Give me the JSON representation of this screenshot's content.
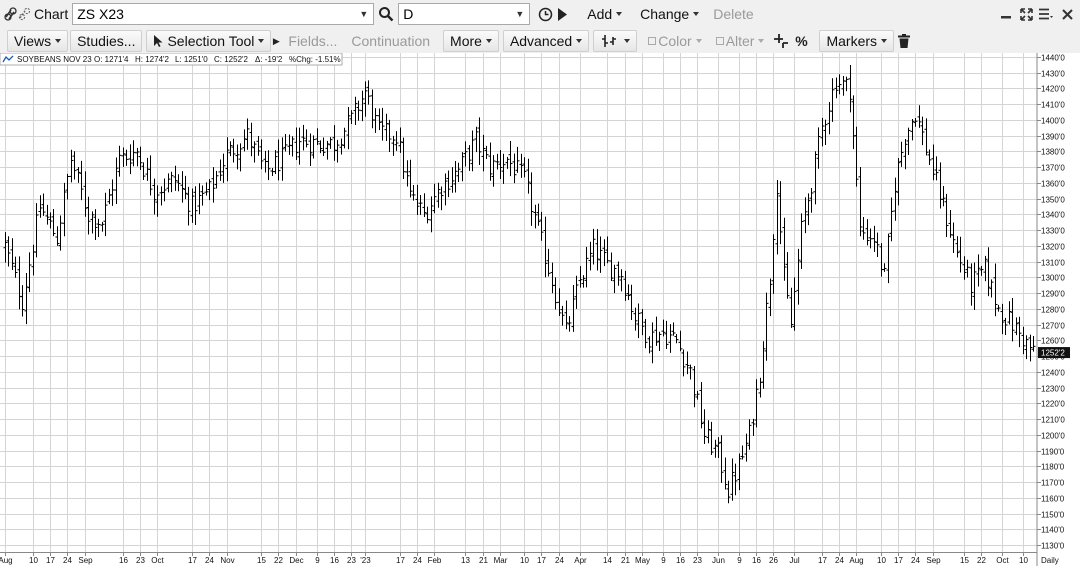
{
  "toolbar": {
    "chart_label": "Chart",
    "symbol": "ZS X23",
    "interval": "D",
    "add_label": "Add",
    "change_label": "Change",
    "delete_label": "Delete"
  },
  "toolbar2": {
    "views_label": "Views",
    "studies_label": "Studies...",
    "selection_tool_label": "Selection Tool",
    "fields_label": "Fields...",
    "continuation_label": "Continuation",
    "more_label": "More",
    "advanced_label": "Advanced",
    "color_label": "Color",
    "alter_label": "Alter",
    "percent_label": "%",
    "markers_label": "Markers"
  },
  "chart_data": {
    "type": "ohlc-bar",
    "title": "SOYBEANS NOV 23",
    "open_label": "O: 1271'4",
    "high_label": "H: 1274'2",
    "low_label": "L: 1251'0",
    "close_label": "C: 1252'2",
    "change_label": "Δ: -19'2",
    "pct_change_label": "%Chg: -1.51%",
    "last_price_label": "1252'2",
    "last_price": 1252.25,
    "period_label": "Daily",
    "ylim": [
      1125,
      1445
    ],
    "y_ticks": [
      "1440'0",
      "1430'0",
      "1420'0",
      "1410'0",
      "1400'0",
      "1390'0",
      "1380'0",
      "1370'0",
      "1360'0",
      "1350'0",
      "1340'0",
      "1330'0",
      "1320'0",
      "1310'0",
      "1300'0",
      "1290'0",
      "1280'0",
      "1270'0",
      "1260'0",
      "1250'0",
      "1240'0",
      "1230'0",
      "1220'0",
      "1210'0",
      "1200'0",
      "1190'0",
      "1180'0",
      "1170'0",
      "1160'0",
      "1150'0",
      "1140'0",
      "1130'0"
    ],
    "x_ticks": [
      {
        "label": "Aug",
        "i": 0
      },
      {
        "label": "10",
        "i": 8
      },
      {
        "label": "17",
        "i": 13
      },
      {
        "label": "24",
        "i": 18
      },
      {
        "label": "Sep",
        "i": 23
      },
      {
        "label": "16",
        "i": 34
      },
      {
        "label": "23",
        "i": 39
      },
      {
        "label": "Oct",
        "i": 44
      },
      {
        "label": "17",
        "i": 54
      },
      {
        "label": "24",
        "i": 59
      },
      {
        "label": "Nov",
        "i": 64
      },
      {
        "label": "15",
        "i": 74
      },
      {
        "label": "22",
        "i": 79
      },
      {
        "label": "Dec",
        "i": 84
      },
      {
        "label": "9",
        "i": 90
      },
      {
        "label": "16",
        "i": 95
      },
      {
        "label": "23",
        "i": 100
      },
      {
        "label": "'23",
        "i": 104
      },
      {
        "label": "17",
        "i": 114
      },
      {
        "label": "24",
        "i": 119
      },
      {
        "label": "Feb",
        "i": 124
      },
      {
        "label": "13",
        "i": 133
      },
      {
        "label": "21",
        "i": 138
      },
      {
        "label": "Mar",
        "i": 143
      },
      {
        "label": "10",
        "i": 150
      },
      {
        "label": "17",
        "i": 155
      },
      {
        "label": "24",
        "i": 160
      },
      {
        "label": "Apr",
        "i": 166
      },
      {
        "label": "14",
        "i": 174
      },
      {
        "label": "21",
        "i": 179
      },
      {
        "label": "May",
        "i": 184
      },
      {
        "label": "9",
        "i": 190
      },
      {
        "label": "16",
        "i": 195
      },
      {
        "label": "23",
        "i": 200
      },
      {
        "label": "Jun",
        "i": 206
      },
      {
        "label": "9",
        "i": 212
      },
      {
        "label": "16",
        "i": 217
      },
      {
        "label": "26",
        "i": 222
      },
      {
        "label": "Jul",
        "i": 228
      },
      {
        "label": "17",
        "i": 236
      },
      {
        "label": "24",
        "i": 241
      },
      {
        "label": "Aug",
        "i": 246
      },
      {
        "label": "10",
        "i": 253
      },
      {
        "label": "17",
        "i": 258
      },
      {
        "label": "24",
        "i": 263
      },
      {
        "label": "Sep",
        "i": 268
      },
      {
        "label": "15",
        "i": 277
      },
      {
        "label": "22",
        "i": 282
      },
      {
        "label": "Oct",
        "i": 288
      },
      {
        "label": "10",
        "i": 294
      }
    ],
    "bar_count": 298,
    "anchors": [
      [
        0,
        1320
      ],
      [
        5,
        1285
      ],
      [
        10,
        1345
      ],
      [
        15,
        1325
      ],
      [
        19,
        1375
      ],
      [
        24,
        1340
      ],
      [
        28,
        1335
      ],
      [
        33,
        1375
      ],
      [
        38,
        1380
      ],
      [
        43,
        1355
      ],
      [
        49,
        1362
      ],
      [
        54,
        1345
      ],
      [
        59,
        1355
      ],
      [
        64,
        1378
      ],
      [
        70,
        1390
      ],
      [
        75,
        1367
      ],
      [
        80,
        1375
      ],
      [
        85,
        1387
      ],
      [
        90,
        1385
      ],
      [
        95,
        1385
      ],
      [
        100,
        1400
      ],
      [
        104,
        1418
      ],
      [
        108,
        1392
      ],
      [
        113,
        1390
      ],
      [
        117,
        1352
      ],
      [
        121,
        1340
      ],
      [
        126,
        1358
      ],
      [
        131,
        1368
      ],
      [
        136,
        1387
      ],
      [
        140,
        1370
      ],
      [
        145,
        1375
      ],
      [
        150,
        1362
      ],
      [
        154,
        1330
      ],
      [
        158,
        1298
      ],
      [
        162,
        1265
      ],
      [
        166,
        1298
      ],
      [
        170,
        1318
      ],
      [
        174,
        1308
      ],
      [
        178,
        1302
      ],
      [
        182,
        1275
      ],
      [
        186,
        1262
      ],
      [
        190,
        1265
      ],
      [
        194,
        1260
      ],
      [
        198,
        1240
      ],
      [
        202,
        1200
      ],
      [
        206,
        1188
      ],
      [
        209,
        1165
      ],
      [
        212,
        1180
      ],
      [
        215,
        1200
      ],
      [
        218,
        1240
      ],
      [
        221,
        1300
      ],
      [
        223,
        1360
      ],
      [
        225,
        1300
      ],
      [
        227,
        1270
      ],
      [
        230,
        1330
      ],
      [
        233,
        1360
      ],
      [
        236,
        1395
      ],
      [
        240,
        1425
      ],
      [
        244,
        1420
      ],
      [
        247,
        1330
      ],
      [
        251,
        1325
      ],
      [
        254,
        1300
      ],
      [
        257,
        1360
      ],
      [
        260,
        1390
      ],
      [
        263,
        1405
      ],
      [
        267,
        1375
      ],
      [
        271,
        1345
      ],
      [
        275,
        1315
      ],
      [
        279,
        1295
      ],
      [
        283,
        1305
      ],
      [
        287,
        1280
      ],
      [
        291,
        1270
      ],
      [
        295,
        1258
      ],
      [
        297,
        1252
      ]
    ]
  }
}
